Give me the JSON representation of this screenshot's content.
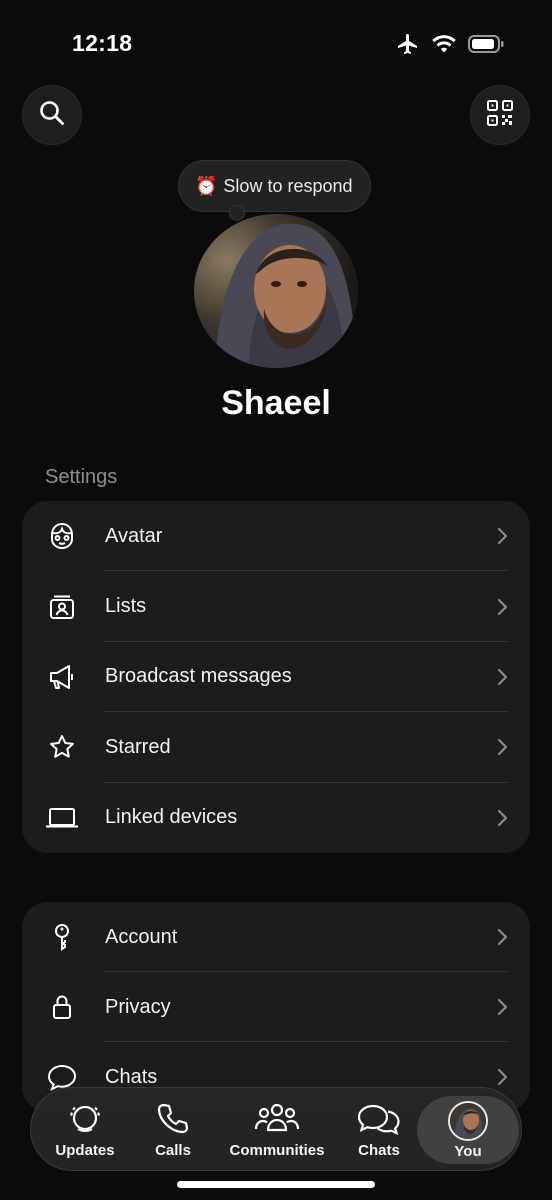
{
  "status_bar": {
    "time": "12:18",
    "icons": [
      "airplane-icon",
      "wifi-icon",
      "battery-icon"
    ]
  },
  "header": {
    "search_icon": "search-icon",
    "qr_icon": "qr-code-icon"
  },
  "profile": {
    "status_emoji": "⏰",
    "status_text": "Slow to respond",
    "name": "Shaeel"
  },
  "settings": {
    "section_label": "Settings",
    "group1": [
      {
        "label": "Avatar",
        "icon": "avatar-face-icon"
      },
      {
        "label": "Lists",
        "icon": "lists-icon"
      },
      {
        "label": "Broadcast messages",
        "icon": "megaphone-icon"
      },
      {
        "label": "Starred",
        "icon": "star-icon"
      },
      {
        "label": "Linked devices",
        "icon": "laptop-icon"
      }
    ],
    "group2": [
      {
        "label": "Account",
        "icon": "key-icon"
      },
      {
        "label": "Privacy",
        "icon": "lock-icon"
      },
      {
        "label": "Chats",
        "icon": "chat-bubble-icon"
      }
    ]
  },
  "tab_bar": {
    "tabs": [
      {
        "label": "Updates",
        "icon": "updates-icon"
      },
      {
        "label": "Calls",
        "icon": "phone-icon"
      },
      {
        "label": "Communities",
        "icon": "communities-icon"
      },
      {
        "label": "Chats",
        "icon": "chats-icon"
      },
      {
        "label": "You",
        "icon": "profile-avatar",
        "active": true
      }
    ]
  },
  "colors": {
    "background": "#0b0b0b",
    "card": "#1c1c1c",
    "text": "#f2f2f2",
    "muted": "#8e8e8e"
  }
}
